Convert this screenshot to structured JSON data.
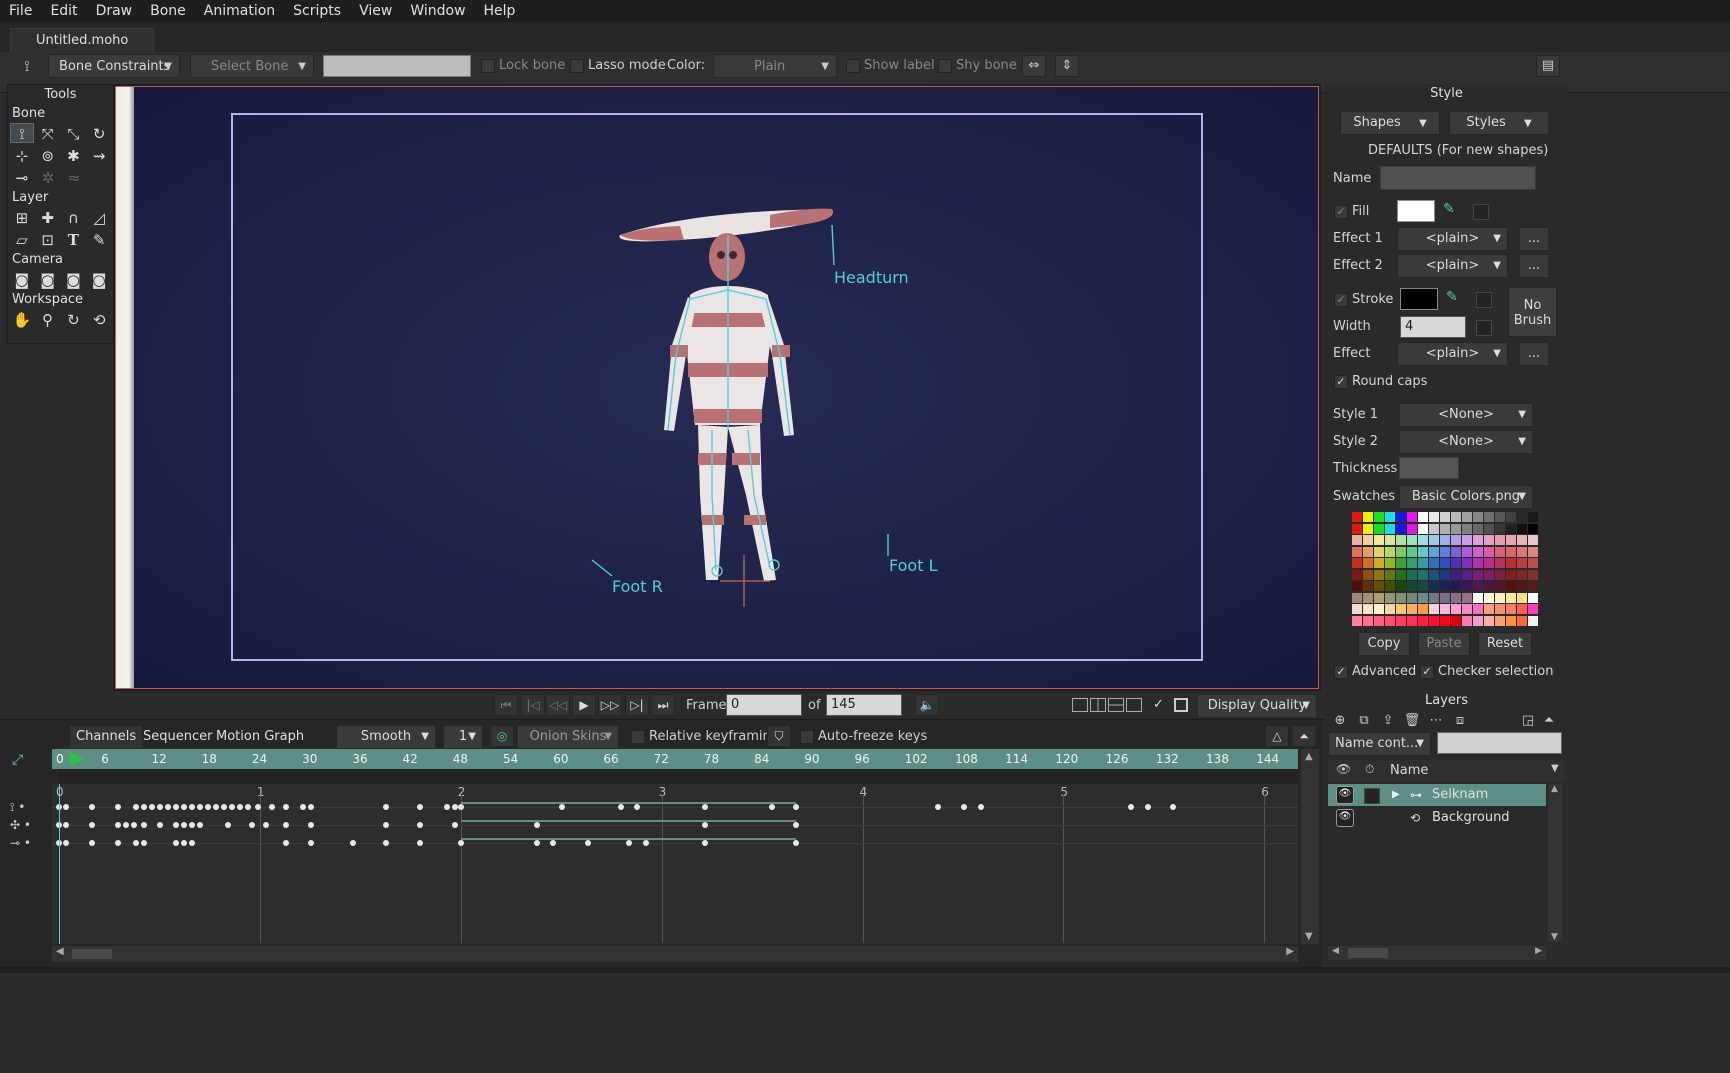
{
  "menu": [
    "File",
    "Edit",
    "Draw",
    "Bone",
    "Animation",
    "Scripts",
    "View",
    "Window",
    "Help"
  ],
  "document_tab": "Untitled.moho",
  "tool_options": {
    "bone_constraints": "Bone Constraints",
    "select_bone": "Select Bone",
    "lock_bone": "Lock bone",
    "lasso_mode": "Lasso mode",
    "color_label": "Color:",
    "color_value": "Plain",
    "show_label": "Show label",
    "shy_bone": "Shy bone"
  },
  "tools": {
    "title": "Tools",
    "groups": [
      "Bone",
      "Layer",
      "Camera",
      "Workspace"
    ]
  },
  "canvas": {
    "bone_labels": [
      "Headturn",
      "Foot R",
      "Foot L"
    ]
  },
  "style": {
    "title": "Style",
    "shapes": "Shapes",
    "styles": "Styles",
    "defaults": "DEFAULTS (For new shapes)",
    "name_label": "Name",
    "fill_label": "Fill",
    "effect1_label": "Effect 1",
    "effect1_value": "<plain>",
    "effect2_label": "Effect 2",
    "effect2_value": "<plain>",
    "stroke_label": "Stroke",
    "no_brush_line1": "No",
    "no_brush_line2": "Brush",
    "width_label": "Width",
    "width_value": "4",
    "effect_label": "Effect",
    "effect_value": "<plain>",
    "round_caps": "Round caps",
    "style1_label": "Style 1",
    "style1_value": "<None>",
    "style2_label": "Style 2",
    "style2_value": "<None>",
    "thickness_label": "Thickness",
    "swatches_label": "Swatches",
    "swatches_value": "Basic Colors.png",
    "copy": "Copy",
    "paste": "Paste",
    "reset": "Reset",
    "advanced": "Advanced",
    "checker_selection": "Checker selection",
    "ellipsis": "..."
  },
  "playback": {
    "frame_label": "Frame",
    "frame_value": "0",
    "of_label": "of",
    "total_frames": "145",
    "display_quality": "Display Quality"
  },
  "timeline": {
    "tabs": [
      "Channels",
      "Sequencer",
      "Motion Graph"
    ],
    "interpolation": "Smooth",
    "interval": "1",
    "onion_skins": "Onion Skins",
    "relative_keyframing": "Relative keyframing",
    "auto_freeze": "Auto-freeze keys",
    "ruler": [
      "0",
      "6",
      "12",
      "18",
      "24",
      "30",
      "36",
      "42",
      "48",
      "54",
      "60",
      "66",
      "72",
      "78",
      "84",
      "90",
      "96",
      "102",
      "108",
      "114",
      "120",
      "126",
      "132",
      "138",
      "144"
    ],
    "seconds": [
      "0",
      "1",
      "2",
      "3",
      "4",
      "5",
      "6"
    ]
  },
  "layers": {
    "title": "Layers",
    "name_cont": "Name cont...",
    "name_header": "Name",
    "items": [
      {
        "name": "Selknam",
        "selected": true
      },
      {
        "name": "Background",
        "selected": false
      }
    ]
  },
  "colors": {
    "accent_teal": "#5e8f86",
    "canvas_bg": "#1c1f43",
    "bone_cyan": "#4fd0d8",
    "frame_border": "#b7b2ee"
  }
}
